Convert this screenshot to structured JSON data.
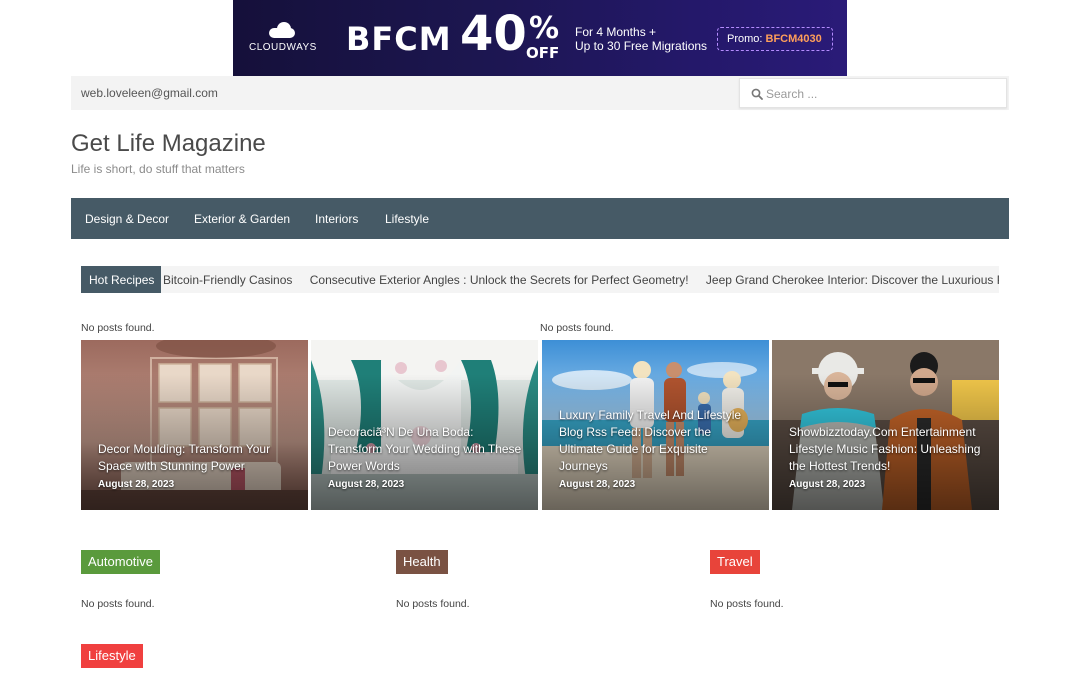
{
  "banner": {
    "brand": "CLOUDWAYS",
    "bfcm": "BFCM",
    "discount": "40",
    "percent": "%",
    "off": "OFF",
    "offer_line1": "For 4 Months +",
    "offer_line2": "Up to 30 Free Migrations",
    "promo_label": "Promo: ",
    "promo_code": "BFCM4030"
  },
  "topbar": {
    "email": "web.loveleen@gmail.com",
    "search_placeholder": "Search ..."
  },
  "site": {
    "title": "Get Life Magazine",
    "tagline": "Life is short, do stuff that matters"
  },
  "nav": {
    "items": [
      {
        "label": "Design & Decor"
      },
      {
        "label": "Exterior & Garden"
      },
      {
        "label": "Interiors"
      },
      {
        "label": "Lifestyle"
      }
    ]
  },
  "ticker": {
    "label": "Hot Recipes",
    "items": [
      "Bitcoin-Friendly Casinos",
      "Consecutive Exterior Angles : Unlock the Secrets for Perfect Geometry!",
      "Jeep Grand Cherokee Interior: Discover the Luxurious Pow"
    ]
  },
  "noposts": {
    "text": "No posts found."
  },
  "cards": [
    {
      "title": "Decor Moulding: Transform Your Space with Stunning Power",
      "date": "August 28, 2023"
    },
    {
      "title": "Decoraciã³N De Una Boda: Transform Your Wedding with These Power Words",
      "date": "August 28, 2023"
    },
    {
      "title": "Luxury Family Travel And Lifestyle Blog Rss Feed: Discover the Ultimate Guide for Exquisite Journeys",
      "date": "August 28, 2023"
    },
    {
      "title": "Showbizztoday.Com Entertainment Lifestyle Music Fashion: Unleashing the Hottest Trends!",
      "date": "August 28, 2023"
    }
  ],
  "categories": [
    {
      "label": "Automotive",
      "color": "#5a9a3c"
    },
    {
      "label": "Health",
      "color": "#7a5243"
    },
    {
      "label": "Travel",
      "color": "#e8443a"
    },
    {
      "label": "Lifestyle",
      "color": "#f0403f"
    }
  ],
  "colors": {
    "nav_bg": "#465a66",
    "topbar_bg": "#f3f3f3"
  }
}
